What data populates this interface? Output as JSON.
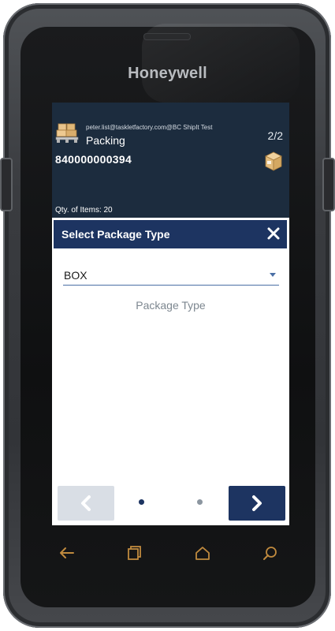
{
  "device": {
    "brand": "Honeywell"
  },
  "header": {
    "user": "peter.list@taskletfactory.com@BC ShipIt Test",
    "title": "Packing",
    "page_indicator": "2/2",
    "order_number": "840000000394",
    "qty_text": "Qty. of Items: 20"
  },
  "dialog": {
    "title": "Select Package Type",
    "select_value": "BOX",
    "field_label": "Package Type"
  },
  "navigation": {
    "total_steps": 2,
    "current_step": 1
  },
  "colors": {
    "header_bg": "#1c2c3e",
    "dialog_bar": "#1d3461",
    "accent": "#4a6fa5",
    "disabled_button": "#d9dee5"
  },
  "icons": [
    "pallet-icon",
    "box-icon",
    "close-icon",
    "chevron-down-icon",
    "chevron-left-icon",
    "chevron-right-icon",
    "back-icon",
    "recent-apps-icon",
    "home-icon",
    "search-icon"
  ]
}
